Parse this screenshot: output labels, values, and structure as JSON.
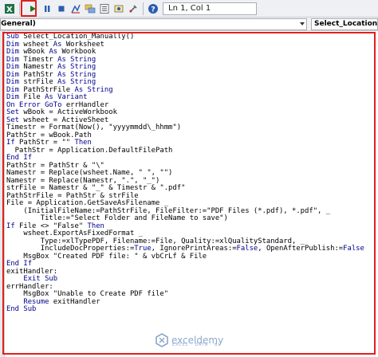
{
  "toolbar": {
    "icons": [
      "run-icon",
      "break-icon",
      "reset-icon",
      "design-mode-icon",
      "project-explorer-icon",
      "properties-icon",
      "object-browser-icon",
      "toolbox-icon",
      "help-icon"
    ],
    "position": "Ln 1, Col 1"
  },
  "dropdowns": {
    "object": "(General)",
    "procedure": "Select_Location_Manually"
  },
  "code_lines": [
    [
      {
        "t": "Sub ",
        "k": true
      },
      {
        "t": "Select_Location_Manually()"
      }
    ],
    [
      {
        "t": "Dim ",
        "k": true
      },
      {
        "t": "wsheet "
      },
      {
        "t": "As ",
        "k": true
      },
      {
        "t": "Worksheet"
      }
    ],
    [
      {
        "t": "Dim ",
        "k": true
      },
      {
        "t": "wBook "
      },
      {
        "t": "As ",
        "k": true
      },
      {
        "t": "Workbook"
      }
    ],
    [
      {
        "t": "Dim ",
        "k": true
      },
      {
        "t": "Timestr "
      },
      {
        "t": "As String",
        "k": true
      }
    ],
    [
      {
        "t": "Dim ",
        "k": true
      },
      {
        "t": "Namestr "
      },
      {
        "t": "As String",
        "k": true
      }
    ],
    [
      {
        "t": "Dim ",
        "k": true
      },
      {
        "t": "PathStr "
      },
      {
        "t": "As String",
        "k": true
      }
    ],
    [
      {
        "t": "Dim ",
        "k": true
      },
      {
        "t": "strFile "
      },
      {
        "t": "As String",
        "k": true
      }
    ],
    [
      {
        "t": "Dim ",
        "k": true
      },
      {
        "t": "PathStrFile "
      },
      {
        "t": "As String",
        "k": true
      }
    ],
    [
      {
        "t": "Dim ",
        "k": true
      },
      {
        "t": "File "
      },
      {
        "t": "As Variant",
        "k": true
      }
    ],
    [
      {
        "t": "On Error GoTo ",
        "k": true
      },
      {
        "t": "errHandler"
      }
    ],
    [
      {
        "t": "Set ",
        "k": true
      },
      {
        "t": "wBook = ActiveWorkbook"
      }
    ],
    [
      {
        "t": "Set ",
        "k": true
      },
      {
        "t": "wsheet = ActiveSheet"
      }
    ],
    [
      {
        "t": "Timestr = Format(Now(), \"yyyymmdd\\_hhmm\")"
      }
    ],
    [
      {
        "t": "PathStr = wBook.Path"
      }
    ],
    [
      {
        "t": "If ",
        "k": true
      },
      {
        "t": "PathStr = \"\" "
      },
      {
        "t": "Then",
        "k": true
      }
    ],
    [
      {
        "t": "  PathStr = Application.DefaultFilePath"
      }
    ],
    [
      {
        "t": "End If",
        "k": true
      }
    ],
    [
      {
        "t": "PathStr = PathStr & \"\\\""
      }
    ],
    [
      {
        "t": "Namestr = Replace(wsheet.Name, \" \", \"\")"
      }
    ],
    [
      {
        "t": "Namestr = Replace(Namestr, \".\", \"_\")"
      }
    ],
    [
      {
        "t": "strFile = Namestr & \"_\" & Timestr & \".pdf\""
      }
    ],
    [
      {
        "t": "PathStrFile = PathStr & strFile"
      }
    ],
    [
      {
        "t": "File = Application.GetSaveAsFilename _"
      }
    ],
    [
      {
        "t": "    (InitialFileName:=PathStrFile, FileFilter:=\"PDF Files (*.pdf), *.pdf\", _"
      }
    ],
    [
      {
        "t": "        Title:=\"Select Folder and FileName to save\")"
      }
    ],
    [
      {
        "t": "If ",
        "k": true
      },
      {
        "t": "File <> \"False\" "
      },
      {
        "t": "Then",
        "k": true
      }
    ],
    [
      {
        "t": "    wsheet.ExportAsFixedFormat _"
      }
    ],
    [
      {
        "t": "        Type:=xlTypePDF, Filename:=File, Quality:=xlQualityStandard, _"
      }
    ],
    [
      {
        "t": "        IncludeDocProperties:="
      },
      {
        "t": "True",
        "k": true
      },
      {
        "t": ", IgnorePrintAreas:="
      },
      {
        "t": "False",
        "k": true
      },
      {
        "t": ", OpenAfterPublish:="
      },
      {
        "t": "False",
        "k": true
      }
    ],
    [
      {
        "t": "    MsgBox \"Created PDF file: \" & vbCrLf & File"
      }
    ],
    [
      {
        "t": "End If",
        "k": true
      }
    ],
    [
      {
        "t": "exitHandler:"
      }
    ],
    [
      {
        "t": "    "
      },
      {
        "t": "Exit Sub",
        "k": true
      }
    ],
    [
      {
        "t": "errHandler:"
      }
    ],
    [
      {
        "t": "    MsgBox \"Unable to Create PDF file\""
      }
    ],
    [
      {
        "t": "    "
      },
      {
        "t": "Resume ",
        "k": true
      },
      {
        "t": "exitHandler"
      }
    ],
    [
      {
        "t": "End Sub",
        "k": true
      }
    ]
  ],
  "watermark": {
    "name": "exceldemy",
    "tagline": "EXCEL · DATA · BI"
  },
  "colors": {
    "keyword": "#00008b",
    "highlight": "#e0201e"
  }
}
